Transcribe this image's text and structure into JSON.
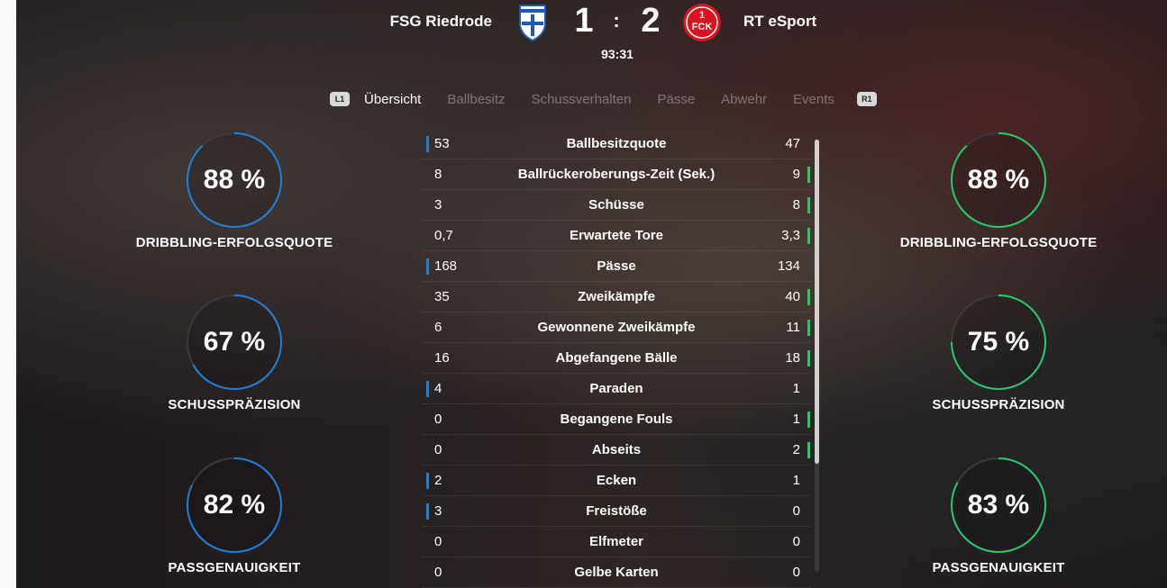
{
  "match": {
    "home_team": "FSG Riedrode",
    "away_team": "RT eSport",
    "home_score": "1",
    "separator": ":",
    "away_score": "2",
    "clock": "93:31",
    "home_crest": "finland-crest",
    "away_crest": "fck-crest",
    "away_crest_text": "FCK"
  },
  "tabs": {
    "left_shoulder": "L1",
    "right_shoulder": "R1",
    "items": [
      {
        "label": "Übersicht",
        "active": true
      },
      {
        "label": "Ballbesitz",
        "active": false
      },
      {
        "label": "Schussverhalten",
        "active": false
      },
      {
        "label": "Pässe",
        "active": false
      },
      {
        "label": "Abwehr",
        "active": false
      },
      {
        "label": "Events",
        "active": false
      }
    ]
  },
  "colors": {
    "home": "#1e7fd8",
    "away": "#26c96b",
    "ring_track": "#3a3a40"
  },
  "home_gauges": [
    {
      "value": "88 %",
      "percent": 88,
      "label": "DRIBBLING-ERFOLGSQUOTE"
    },
    {
      "value": "67 %",
      "percent": 67,
      "label": "SCHUSSPRÄZISION"
    },
    {
      "value": "82 %",
      "percent": 82,
      "label": "PASSGENAUIGKEIT"
    }
  ],
  "away_gauges": [
    {
      "value": "88 %",
      "percent": 88,
      "label": "DRIBBLING-ERFOLGSQUOTE"
    },
    {
      "value": "75 %",
      "percent": 75,
      "label": "SCHUSSPRÄZISION"
    },
    {
      "value": "83 %",
      "percent": 83,
      "label": "PASSGENAUIGKEIT"
    }
  ],
  "stats": [
    {
      "home": "53",
      "label": "Ballbesitzquote",
      "away": "47",
      "leader": "home"
    },
    {
      "home": "8",
      "label": "Ballrückeroberungs-Zeit (Sek.)",
      "away": "9",
      "leader": "away"
    },
    {
      "home": "3",
      "label": "Schüsse",
      "away": "8",
      "leader": "away"
    },
    {
      "home": "0,7",
      "label": "Erwartete Tore",
      "away": "3,3",
      "leader": "away"
    },
    {
      "home": "168",
      "label": "Pässe",
      "away": "134",
      "leader": "home"
    },
    {
      "home": "35",
      "label": "Zweikämpfe",
      "away": "40",
      "leader": "away"
    },
    {
      "home": "6",
      "label": "Gewonnene Zweikämpfe",
      "away": "11",
      "leader": "away"
    },
    {
      "home": "16",
      "label": "Abgefangene Bälle",
      "away": "18",
      "leader": "away"
    },
    {
      "home": "4",
      "label": "Paraden",
      "away": "1",
      "leader": "home"
    },
    {
      "home": "0",
      "label": "Begangene Fouls",
      "away": "1",
      "leader": "away"
    },
    {
      "home": "0",
      "label": "Abseits",
      "away": "2",
      "leader": "away"
    },
    {
      "home": "2",
      "label": "Ecken",
      "away": "1",
      "leader": "home"
    },
    {
      "home": "3",
      "label": "Freistöße",
      "away": "0",
      "leader": "home"
    },
    {
      "home": "0",
      "label": "Elfmeter",
      "away": "0",
      "leader": "none"
    },
    {
      "home": "0",
      "label": "Gelbe Karten",
      "away": "0",
      "leader": "none"
    }
  ]
}
